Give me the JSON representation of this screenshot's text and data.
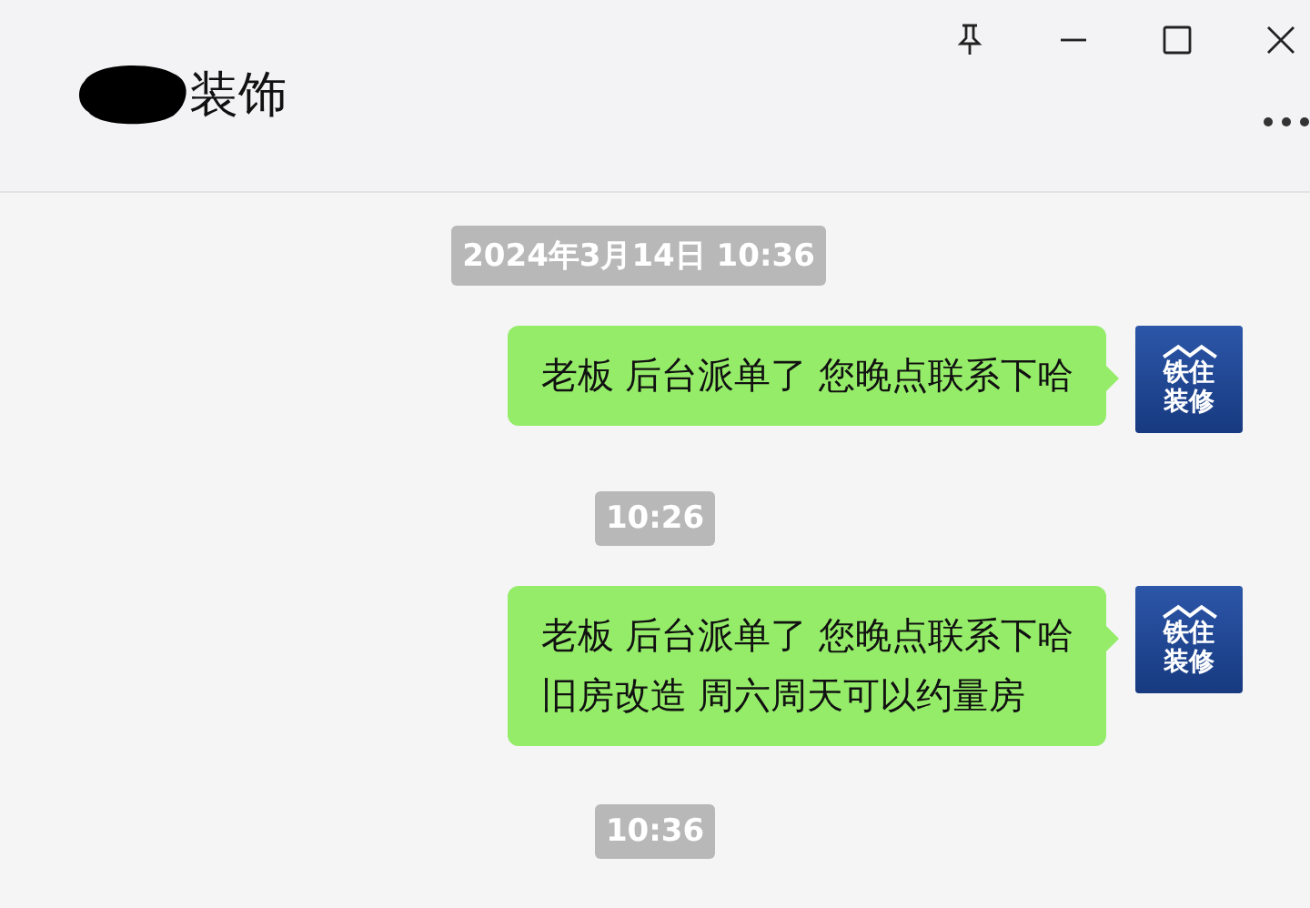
{
  "window": {
    "title": "装饰",
    "title_redacted": true
  },
  "messages": [
    {
      "kind": "time",
      "text": "2024年3月14日 10:36"
    },
    {
      "kind": "outgoing",
      "lines": [
        "老板 后台派单了 您晚点联系下哈"
      ],
      "avatar_text": [
        "铁住",
        "装修"
      ]
    },
    {
      "kind": "time",
      "text": "10:26"
    },
    {
      "kind": "outgoing",
      "lines": [
        "老板 后台派单了 您晚点联系下哈",
        "旧房改造 周六周天可以约量房"
      ],
      "avatar_text": [
        "铁住",
        "装修"
      ]
    },
    {
      "kind": "time",
      "text": "10:36"
    }
  ]
}
